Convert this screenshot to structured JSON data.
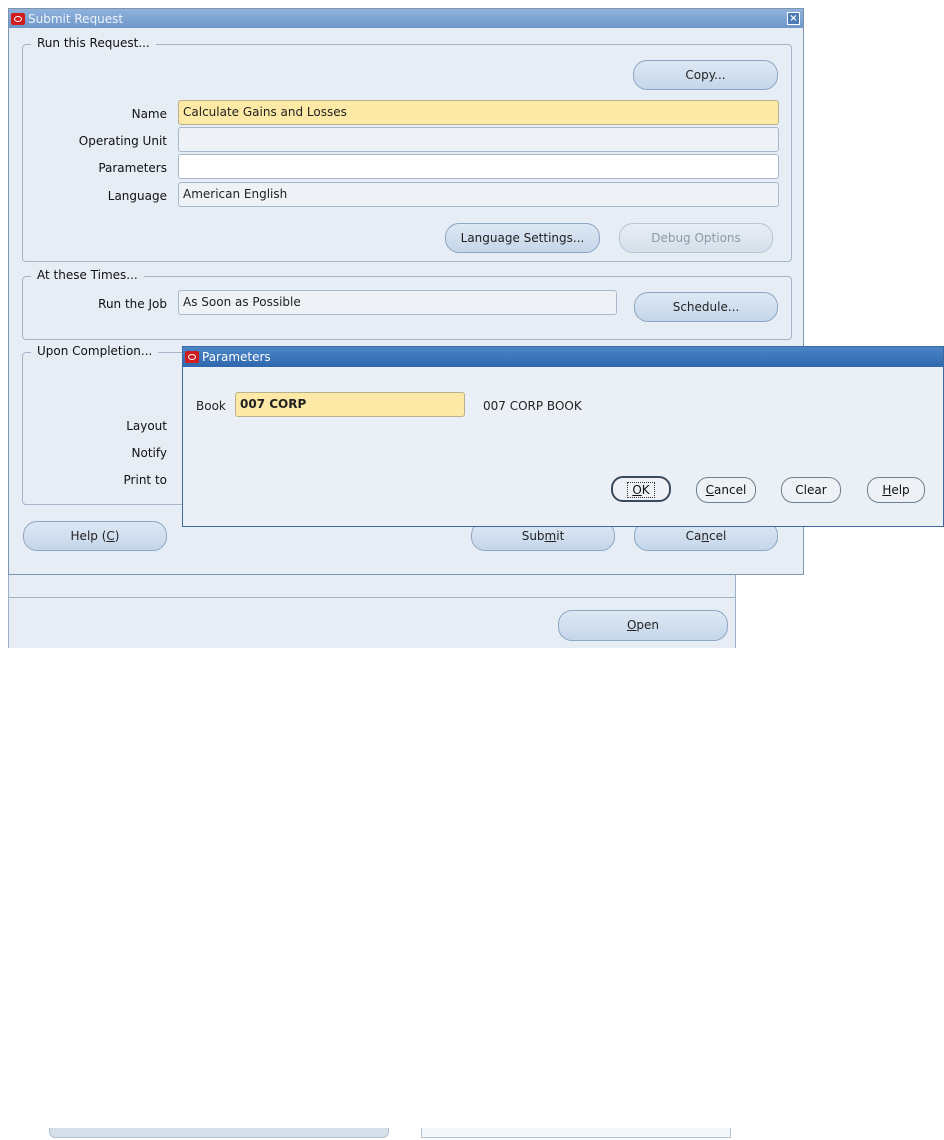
{
  "main_dialog": {
    "title": "Submit Request",
    "run_group": {
      "legend": "Run this Request...",
      "copy_label": "Copy...",
      "name_label": "Name",
      "name_value": "Calculate Gains and Losses",
      "operating_unit_label": "Operating Unit",
      "operating_unit_value": "",
      "parameters_label": "Parameters",
      "parameters_value": "",
      "language_label": "Language",
      "language_value": "American English",
      "language_settings_label": "Language Settings...",
      "debug_options_label": "Debug Options"
    },
    "times_group": {
      "legend": "At these Times...",
      "run_job_label": "Run the Job",
      "run_job_value": "As Soon as Possible",
      "schedule_label": "Schedule..."
    },
    "completion_group": {
      "legend": "Upon Completion...",
      "layout_label": "Layout",
      "notify_label": "Notify",
      "print_to_label": "Print to"
    },
    "help_label": "Help (C)",
    "submit_label": "Submit",
    "cancel_label": "Cancel"
  },
  "background_window": {
    "open_label": "Open"
  },
  "parameters_dialog": {
    "title": "Parameters",
    "book_label": "Book",
    "book_value": "007 CORP",
    "book_description": "007 CORP BOOK",
    "ok_label": "OK",
    "cancel_label": "Cancel",
    "clear_label": "Clear",
    "help_label": "Help"
  },
  "colors": {
    "title_inactive": "#7aa2d2",
    "title_active": "#3a72b8",
    "required_field": "#fce9a5",
    "dialog_bg": "#e6edf4"
  }
}
